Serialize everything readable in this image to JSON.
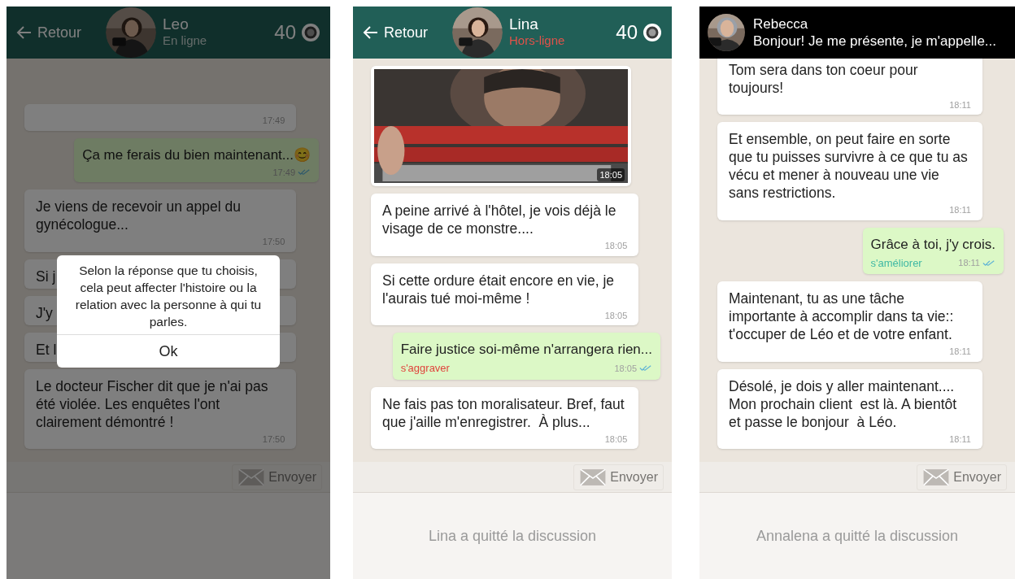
{
  "phones": [
    {
      "header": {
        "kind": "chat",
        "back_label": "Retour",
        "name": "Leo",
        "status": "En ligne",
        "online": true,
        "coins": "40"
      },
      "messages": [
        {
          "kind": "in",
          "time": "17:49"
        },
        {
          "kind": "out",
          "text": "Ça me ferais du bien maintenant...😊",
          "time": "17:49",
          "read": true
        },
        {
          "kind": "in",
          "text": "Je viens de recevoir un appel du gynécologue...",
          "time": "17:50"
        },
        {
          "kind": "in",
          "text": "Si j"
        },
        {
          "kind": "in",
          "text": "J'y"
        },
        {
          "kind": "in",
          "text": "Et l"
        },
        {
          "kind": "in",
          "text": "Le docteur Fischer dit que je n'ai pas été violée. Les enquêtes l'ont clairement démontré !",
          "time": "17:50"
        }
      ],
      "send_button": {
        "label": "Envoyer",
        "disabled": true
      },
      "dialog": {
        "text": "Selon la réponse que tu choisis, cela peut affecter l'histoire ou la relation avec la personne à qui tu parles.",
        "button": "Ok"
      }
    },
    {
      "header": {
        "kind": "chat",
        "back_label": "Retour",
        "name": "Lina",
        "status": "Hors-ligne",
        "online": false,
        "coins": "40"
      },
      "messages": [
        {
          "time": "18:05"
        },
        {
          "kind": "in",
          "text": "A peine arrivé à l'hôtel, je vois déjà le visage de ce monstre....",
          "time": "18:05"
        },
        {
          "kind": "in",
          "text": "Si cette ordure était encore en vie, je l'aurais tué moi-même !",
          "time": "18:05"
        },
        {
          "kind": "out",
          "text": "Faire justice soi-même n'arrangera rien...",
          "time": "18:05",
          "read": true,
          "effect": {
            "text": "s'aggraver",
            "kind": "worse"
          }
        },
        {
          "kind": "in",
          "text": "Ne fais pas ton moralisateur. Bref, faut que j'aille m'enregistrer.  À plus...",
          "time": "18:05"
        }
      ],
      "send_button": {
        "label": "Envoyer",
        "disabled": true
      },
      "notice": "Lina a quitté la discussion"
    },
    {
      "header": {
        "kind": "preview",
        "name": "Rebecca",
        "status": "Bonjour! Je me présente, je m'appelle..."
      },
      "messages": [
        {
          "kind": "in",
          "text": "Tom sera dans ton coeur pour toujours!",
          "time": "18:11"
        },
        {
          "kind": "in",
          "text": "Et ensemble, on peut faire en sorte que tu puisses survivre à ce que tu as vécu et mener à nouveau une vie sans restrictions.",
          "time": "18:11"
        },
        {
          "kind": "out",
          "text": "Grâce à toi, j'y crois.",
          "time": "18:11",
          "read": true,
          "effect": {
            "text": "s'améliorer",
            "kind": "better"
          }
        },
        {
          "kind": "in",
          "text": "Maintenant, tu as une tâche importante à accomplir dans ta vie:: t'occuper de Léo et de votre enfant.",
          "time": "18:11"
        },
        {
          "kind": "in",
          "text": "Désolé, je dois y aller maintenant.... Mon prochain client  est là. A bientôt et passe le bonjour  à Léo.",
          "time": "18:11"
        }
      ],
      "send_button": {
        "label": "Envoyer",
        "disabled": true
      },
      "notice": "Annalena a quitté la discussion"
    }
  ]
}
